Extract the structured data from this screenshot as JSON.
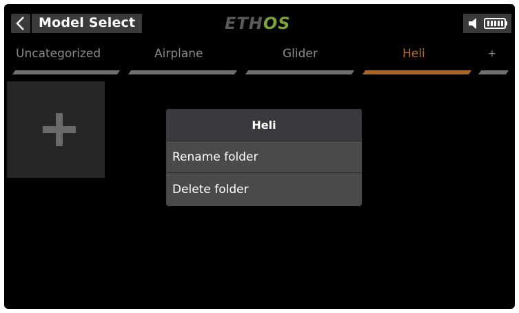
{
  "header": {
    "title": "Model Select",
    "logo_left": "ETH",
    "logo_right": "OS",
    "logo_color": "#7ba43a"
  },
  "tabs": [
    {
      "label": "Uncategorized",
      "active": false
    },
    {
      "label": "Airplane",
      "active": false
    },
    {
      "label": "Glider",
      "active": false
    },
    {
      "label": "Heli",
      "active": true
    },
    {
      "label": "+",
      "active": false
    }
  ],
  "active_tab_color": "#a8662a",
  "dialog": {
    "title": "Heli",
    "items": [
      "Rename folder",
      "Delete folder"
    ]
  },
  "icons": {
    "back": "chevron-left-icon",
    "speaker": "speaker-icon",
    "battery": "battery-icon",
    "add": "plus-icon"
  }
}
